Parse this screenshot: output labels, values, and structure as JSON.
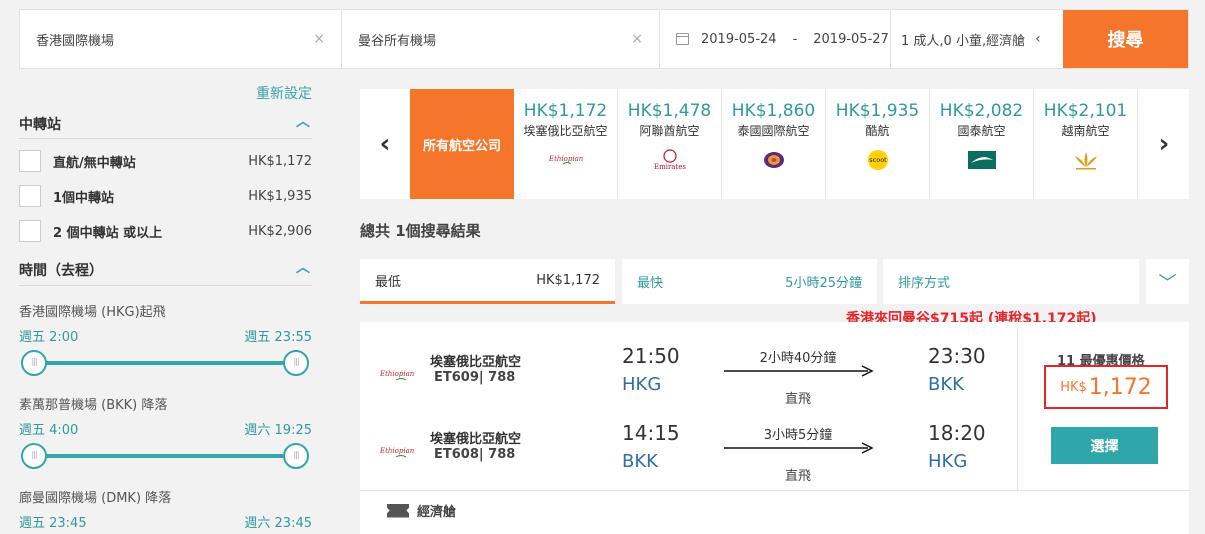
{
  "search": {
    "from": "香港國際機場",
    "to": "曼谷所有機場",
    "depart_date": "2019-05-24",
    "date_sep": "-",
    "return_date": "2019-05-27",
    "passengers": "1 成人,0 小童,經濟艙",
    "clear_icon": "×",
    "pax_arrow": "‹",
    "search_label": "搜尋"
  },
  "sidebar": {
    "reset": "重新設定",
    "stops_title": "中轉站",
    "stops": [
      {
        "label": "直航/無中轉站",
        "price": "HK$1,172"
      },
      {
        "label": "1個中轉站",
        "price": "HK$1,935"
      },
      {
        "label": "2 個中轉站 或以上",
        "price": "HK$2,906"
      }
    ],
    "time_title": "時間（去程）",
    "time_filters": [
      {
        "label": "香港國際機場 (HKG)起飛",
        "min": "週五 2:00",
        "max": "週五 23:55"
      },
      {
        "label": "素萬那普機場 (BKK) 降落",
        "min": "週五 4:00",
        "max": "週六 19:25"
      },
      {
        "label": "廊曼國際機場 (DMK) 降落",
        "min": "週五 23:45",
        "max": "週六 23:45"
      }
    ]
  },
  "airline_strip": {
    "all_label": "所有航空公司",
    "prev_icon": "‹",
    "next_icon": "›",
    "airlines": [
      {
        "price": "HK$1,172",
        "name": "埃塞俄比亞航空",
        "logo": "Ethiopian"
      },
      {
        "price": "HK$1,478",
        "name": "阿聯酋航空",
        "logo": "Emirates"
      },
      {
        "price": "HK$1,860",
        "name": "泰國國際航空",
        "logo": "thai-icon"
      },
      {
        "price": "HK$1,935",
        "name": "酷航",
        "logo": "scoot"
      },
      {
        "price": "HK$2,082",
        "name": "國泰航空",
        "logo": "cathay-icon"
      },
      {
        "price": "HK$2,101",
        "name": "越南航空",
        "logo": "lotus-icon"
      }
    ]
  },
  "results": {
    "count_text": "總共 1個搜尋結果",
    "sort": {
      "cheapest_label": "最低",
      "cheapest_value": "HK$1,172",
      "fastest_label": "最快",
      "fastest_value": "5小時25分鐘",
      "sort_by_label": "排序方式"
    },
    "promo": "香港來回曼谷$715起 (連稅$1,172起)",
    "card": {
      "legs": [
        {
          "airline": "埃塞俄比亞航空",
          "flight": "ET609| 788",
          "dep_time": "21:50",
          "dep_code": "HKG",
          "duration": "2小時40分鐘",
          "stops": "直飛",
          "arr_time": "23:30",
          "arr_code": "BKK"
        },
        {
          "airline": "埃塞俄比亞航空",
          "flight": "ET608| 788",
          "dep_time": "14:15",
          "dep_code": "BKK",
          "duration": "3小時5分鐘",
          "stops": "直飛",
          "arr_time": "18:20",
          "arr_code": "HKG"
        }
      ],
      "best_label": "11 最優惠價格",
      "currency": "HK$",
      "amount": "1,172",
      "select_label": "選擇",
      "cabin": "經濟艙"
    }
  },
  "colors": {
    "accent_orange": "#f5762a",
    "teal": "#2fa6a9",
    "promo_red": "#e5252a"
  }
}
